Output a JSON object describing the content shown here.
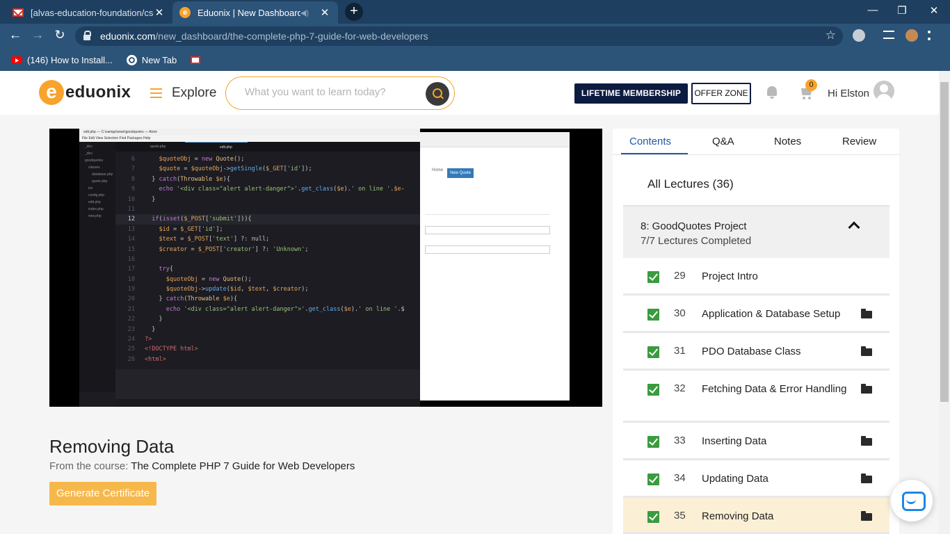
{
  "browser": {
    "tabs": [
      {
        "title": "[alvas-education-foundation/cse]",
        "icon": "gmail-icon"
      },
      {
        "title": "Eduonix | New Dashboard",
        "icon": "eduonix-icon"
      }
    ],
    "url_host": "eduonix.com",
    "url_path": "/new_dashboard/the-complete-php-7-guide-for-web-developers",
    "bookmarks": [
      {
        "label": "(146) How to Install...",
        "icon": "youtube-icon"
      },
      {
        "label": "New Tab",
        "icon": "globe-icon"
      },
      {
        "label": "",
        "icon": "gmail-icon"
      }
    ]
  },
  "header": {
    "logo_text": "eduonix",
    "explore": "Explore",
    "search_placeholder": "What you want to learn today?",
    "lifetime": "LIFETIME MEMBERSHIP",
    "offer": "OFFER ZONE",
    "cart_count": "0",
    "greeting": "Hi Elston"
  },
  "video": {
    "editor_title": "edit.php — C:\\xampp\\www\\goodquotes — Atom",
    "editor_menu": "File  Edit  View  Selection  Find  Packages  Help",
    "tree": [
      "_dev",
      "_dev",
      "goodquotes",
      "classes",
      "database.php",
      "quote.php",
      "inc",
      "config.php",
      "edit.php",
      "index.php",
      "new.php"
    ],
    "tabs": [
      "quote.php",
      "edit.php"
    ],
    "browser_nav": "Home",
    "browser_button": "New Quote",
    "code_lines": [
      {
        "n": "6",
        "t": "    $quoteObj = new Quote();"
      },
      {
        "n": "7",
        "t": "    $quote = $quoteObj->getSingle($_GET['id']);"
      },
      {
        "n": "8",
        "t": "  } catch(Throwable $e){"
      },
      {
        "n": "9",
        "t": "    echo '<div class=\"alert alert-danger\">'.get_class($e).' on line '.$e-"
      },
      {
        "n": "10",
        "t": "  }"
      },
      {
        "n": "11",
        "t": ""
      },
      {
        "n": "12",
        "t": "  if(isset($_POST['submit'])){"
      },
      {
        "n": "13",
        "t": "    $id = $_GET['id'];"
      },
      {
        "n": "14",
        "t": "    $text = $_POST['text'] ?: null;"
      },
      {
        "n": "15",
        "t": "    $creator = $_POST['creator'] ?: 'Unknown';"
      },
      {
        "n": "16",
        "t": ""
      },
      {
        "n": "17",
        "t": "    try{"
      },
      {
        "n": "18",
        "t": "      $quoteObj = new Quote();"
      },
      {
        "n": "19",
        "t": "      $quoteObj->update($id, $text, $creator);"
      },
      {
        "n": "20",
        "t": "    } catch(Throwable $e){"
      },
      {
        "n": "21",
        "t": "      echo '<div class=\"alert alert-danger\">'.get_class($e).' on line '.$"
      },
      {
        "n": "22",
        "t": "    }"
      },
      {
        "n": "23",
        "t": "  }"
      },
      {
        "n": "24",
        "t": "?>"
      },
      {
        "n": "25",
        "t": "<!DOCTYPE html>"
      },
      {
        "n": "26",
        "t": "<html>"
      }
    ]
  },
  "lecture": {
    "title": "Removing Data",
    "from_label": "From the course:",
    "course": "The Complete PHP 7 Guide for Web Developers",
    "certificate_btn": "Generate Certificate"
  },
  "panel": {
    "tabs": [
      "Contents",
      "Q&A",
      "Notes",
      "Review"
    ],
    "all_lectures": "All Lectures (36)",
    "section_title": "8: GoodQuotes Project",
    "section_sub": "7/7 Lectures Completed",
    "lectures": [
      {
        "num": "29",
        "name": "Project Intro",
        "folder": false
      },
      {
        "num": "30",
        "name": "Application & Database Setup",
        "folder": true
      },
      {
        "num": "31",
        "name": "PDO Database Class",
        "folder": true
      },
      {
        "num": "32",
        "name": "Fetching Data & Error Handling",
        "folder": true
      },
      {
        "num": "33",
        "name": "Inserting Data",
        "folder": true
      },
      {
        "num": "34",
        "name": "Updating Data",
        "folder": true
      },
      {
        "num": "35",
        "name": "Removing Data",
        "folder": true
      }
    ]
  },
  "colors": {
    "brand": "#f7a32c",
    "accent": "#1f5aa6",
    "dark": "#0c1b3f",
    "active_row": "#fbf0d6"
  }
}
